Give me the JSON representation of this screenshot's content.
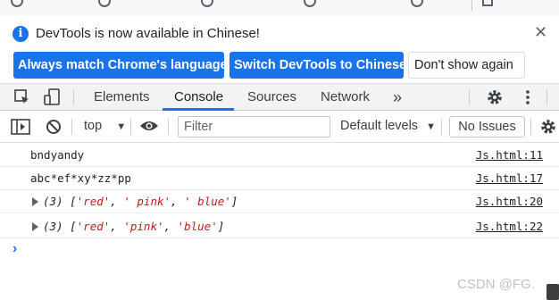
{
  "bookmarks": [
    "",
    "",
    "",
    "",
    ""
  ],
  "infobar": {
    "message": "DevTools is now available in Chinese!",
    "info_icon": "info-icon",
    "close_icon": "close-icon",
    "buttons": {
      "match_language": "Always match Chrome's language",
      "switch_chinese": "Switch DevTools to Chinese",
      "dont_show": "Don't show again"
    }
  },
  "tabs": {
    "elements": "Elements",
    "console": "Console",
    "sources": "Sources",
    "network": "Network",
    "more": "»"
  },
  "console_toolbar": {
    "context": "top",
    "filter_placeholder": "Filter",
    "default_levels": "Default levels",
    "no_issues": "No Issues"
  },
  "messages": [
    {
      "text": "bndyandy",
      "source": "Js.html:11"
    },
    {
      "text": "abc*ef*xy*zz*pp",
      "source": "Js.html:17"
    },
    {
      "prefix": "(3) [",
      "items": [
        "'red'",
        ", ",
        "' pink'",
        ", ",
        "' blue'"
      ],
      "suffix": "]",
      "source": "Js.html:20"
    },
    {
      "prefix": "(3) [",
      "items": [
        "'red'",
        ", ",
        "'pink'",
        ", ",
        "'blue'"
      ],
      "suffix": "]",
      "source": "Js.html:22"
    }
  ],
  "prompt": "›",
  "watermark": "CSDN @FG.",
  "colors": {
    "accent": "#1a73e8",
    "string": "#c41a16"
  }
}
